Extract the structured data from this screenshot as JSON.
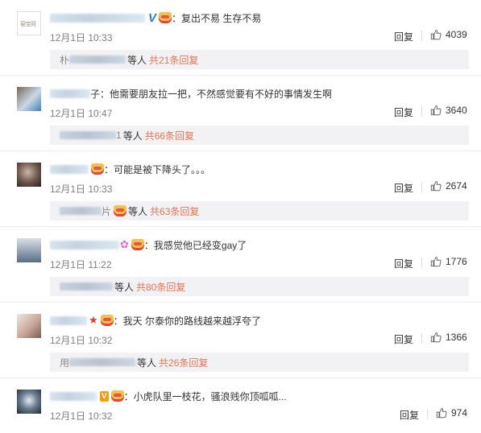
{
  "comments": [
    {
      "name_fragment": "",
      "badge": "V",
      "text": "：复出不易 生存不易",
      "time": "12月1日 10:33",
      "reply_label": "回复",
      "likes": "4039",
      "avatar_text": "窑宝窕",
      "sub": {
        "name_prefix": "朴",
        "name_suffix": "",
        "others": "等人",
        "total": "共21条回复"
      }
    },
    {
      "name_fragment": "子",
      "badge": "",
      "text": "：他需要朋友拉一把，不然感觉要有不好的事情发生啊",
      "time": "12月1日 10:47",
      "reply_label": "回复",
      "likes": "3640",
      "sub": {
        "name_prefix": "",
        "name_suffix": "1",
        "others": "等人",
        "total": "共66条回复"
      }
    },
    {
      "name_fragment": "",
      "badge": "",
      "text": "：可能是被下降头了。。。",
      "time": "12月1日 10:33",
      "reply_label": "回复",
      "likes": "2674",
      "sub": {
        "name_prefix": "",
        "name_suffix": "片",
        "others": "等人",
        "total": "共63条回复"
      }
    },
    {
      "name_fragment": "",
      "badge": "",
      "text": "：我感觉他已经变gay了",
      "time": "12月1日 11:22",
      "reply_label": "回复",
      "likes": "1776",
      "sub": {
        "name_prefix": "",
        "name_suffix": "",
        "others": "等人",
        "total": "共80条回复"
      }
    },
    {
      "name_fragment": "",
      "badge": "",
      "text": "：我天 尔泰你的路线越来越浮夸了",
      "time": "12月1日 10:32",
      "reply_label": "回复",
      "likes": "1366",
      "sub": {
        "name_prefix": "用",
        "name_suffix": "",
        "others": "等人",
        "total": "共26条回复"
      }
    },
    {
      "name_fragment": "",
      "badge": "V",
      "text": "：小虎队里一枝花，骚浪贱你顶呱呱...",
      "time": "12月1日 10:32",
      "reply_label": "回复",
      "likes": "974"
    }
  ],
  "colors": {
    "link": "#eb7350",
    "verified_blue": "#2e7bd2",
    "verified_orange": "#f39c12",
    "muted": "#808080"
  },
  "icons": {
    "like": "thumbs-up-icon",
    "vip": "crown-icon"
  }
}
